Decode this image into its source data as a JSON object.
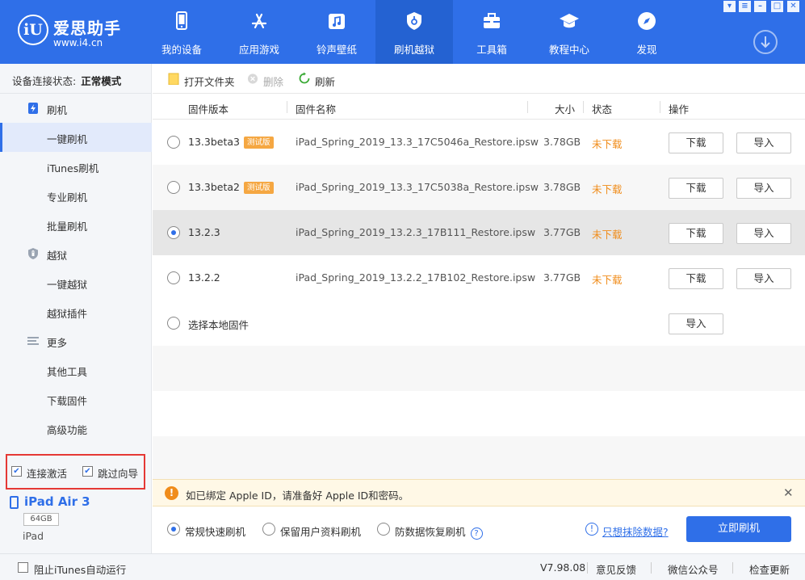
{
  "app": {
    "logo_mark": "iU",
    "title": "爱思助手",
    "url": "www.i4.cn"
  },
  "nav": [
    {
      "label": "我的设备",
      "icon": "phone-icon"
    },
    {
      "label": "应用游戏",
      "icon": "app-store-icon"
    },
    {
      "label": "铃声壁纸",
      "icon": "music-icon"
    },
    {
      "label": "刷机越狱",
      "icon": "shield-icon",
      "active": true
    },
    {
      "label": "工具箱",
      "icon": "toolbox-icon"
    },
    {
      "label": "教程中心",
      "icon": "graduation-cap-icon"
    },
    {
      "label": "发现",
      "icon": "compass-icon"
    }
  ],
  "window_controls": [
    "shirt-icon",
    "menu-icon",
    "minimize-icon",
    "maximize-icon",
    "close-icon"
  ],
  "sidebar": {
    "status_label": "设备连接状态:",
    "status_value": "正常模式",
    "groups": [
      {
        "label": "刷机",
        "icon": "flash-icon",
        "items": [
          "一键刷机",
          "iTunes刷机",
          "专业刷机",
          "批量刷机"
        ]
      },
      {
        "label": "越狱",
        "icon": "shield-lock-icon",
        "items": [
          "一键越狱",
          "越狱插件"
        ]
      },
      {
        "label": "更多",
        "icon": "list-icon",
        "items": [
          "其他工具",
          "下载固件",
          "高级功能"
        ]
      }
    ],
    "active_item": "一键刷机",
    "options": {
      "auto_activate": "连接激活",
      "skip_guide": "跳过向导"
    },
    "device": {
      "name": "iPad Air 3",
      "capacity": "64GB",
      "type": "iPad"
    }
  },
  "toolbar": {
    "open_folder": "打开文件夹",
    "delete": "删除",
    "refresh": "刷新"
  },
  "table": {
    "headers": {
      "version": "固件版本",
      "name": "固件名称",
      "size": "大小",
      "status": "状态",
      "action": "操作"
    },
    "download_label": "下载",
    "import_label": "导入",
    "rows": [
      {
        "version": "13.3beta3",
        "badge": "测试版",
        "name": "iPad_Spring_2019_13.3_17C5046a_Restore.ipsw",
        "size": "3.78GB",
        "status": "未下载",
        "selected": false
      },
      {
        "version": "13.3beta2",
        "badge": "测试版",
        "name": "iPad_Spring_2019_13.3_17C5038a_Restore.ipsw",
        "size": "3.78GB",
        "status": "未下载",
        "selected": false
      },
      {
        "version": "13.2.3",
        "badge": "",
        "name": "iPad_Spring_2019_13.2.3_17B111_Restore.ipsw",
        "size": "3.77GB",
        "status": "未下载",
        "selected": true
      },
      {
        "version": "13.2.2",
        "badge": "",
        "name": "iPad_Spring_2019_13.2.2_17B102_Restore.ipsw",
        "size": "3.77GB",
        "status": "未下载",
        "selected": false
      }
    ],
    "local_firmware": "选择本地固件"
  },
  "notice": {
    "text": "如已绑定 Apple ID，请准备好 Apple ID和密码。"
  },
  "flash_options": {
    "modes": [
      {
        "label": "常规快速刷机",
        "selected": true
      },
      {
        "label": "保留用户资料刷机",
        "selected": false
      },
      {
        "label": "防数据恢复刷机",
        "selected": false
      }
    ],
    "help_mark": "?",
    "wipe_link": "只想抹除数据?",
    "flash_button": "立即刷机"
  },
  "statusbar": {
    "block_itunes": "阻止iTunes自动运行",
    "version": "V7.98.08",
    "feedback": "意见反馈",
    "wechat": "微信公众号",
    "check_update": "检查更新"
  },
  "colors": {
    "brand": "#2f6fe8",
    "status_warn": "#f08c1a",
    "badge": "#f5a742",
    "highlight_border": "#e53935"
  }
}
